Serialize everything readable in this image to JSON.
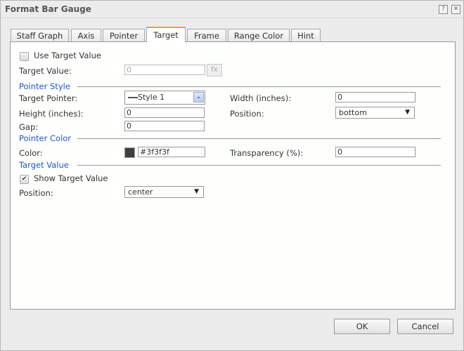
{
  "dialog": {
    "title": "Format Bar Gauge",
    "help_icon": "?",
    "close_icon": "✕"
  },
  "tabs": [
    {
      "label": "Staff Graph",
      "active": false
    },
    {
      "label": "Axis",
      "active": false
    },
    {
      "label": "Pointer",
      "active": false
    },
    {
      "label": "Target",
      "active": true
    },
    {
      "label": "Frame",
      "active": false
    },
    {
      "label": "Range Color",
      "active": false
    },
    {
      "label": "Hint",
      "active": false
    }
  ],
  "target": {
    "use_target_value": {
      "label": "Use Target Value",
      "checked": false
    },
    "target_value": {
      "label": "Target Value:",
      "value": "0",
      "fx_label": "fx"
    }
  },
  "pointer_style": {
    "section": "Pointer Style",
    "target_pointer": {
      "label": "Target Pointer:",
      "value": "Style 1"
    },
    "width": {
      "label": "Width (inches):",
      "value": "0"
    },
    "height": {
      "label": "Height (inches):",
      "value": "0"
    },
    "position": {
      "label": "Position:",
      "value": "bottom"
    },
    "gap": {
      "label": "Gap:",
      "value": "0"
    }
  },
  "pointer_color": {
    "section": "Pointer Color",
    "color": {
      "label": "Color:",
      "value": "#3f3f3f",
      "swatch": "#3f3f3f"
    },
    "transparency": {
      "label": "Transparency (%):",
      "value": "0"
    }
  },
  "target_value_section": {
    "section": "Target Value",
    "show_target_value": {
      "label": "Show Target Value",
      "checked": true
    },
    "position": {
      "label": "Position:",
      "value": "center"
    }
  },
  "footer": {
    "ok_label": "OK",
    "cancel_label": "Cancel"
  },
  "icons": {
    "checkmark": "✔",
    "dropdown_arrow": "▼",
    "combo_chevron": "⌄"
  }
}
